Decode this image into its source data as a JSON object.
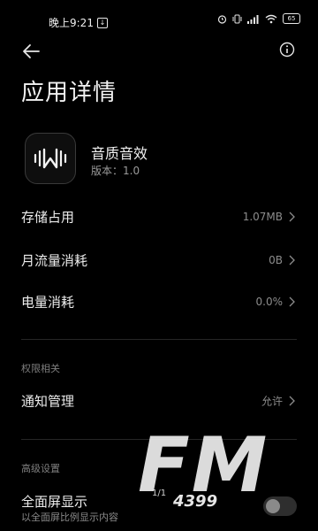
{
  "status_bar": {
    "time": "晚上9:21",
    "battery": "65"
  },
  "header": {
    "back_icon": "arrow-left-icon",
    "info_icon": "info-icon",
    "title": "应用详情"
  },
  "app": {
    "icon": "app-logo-icon",
    "name": "音质音效",
    "version": "版本：1.0"
  },
  "usage": [
    {
      "label": "存储占用",
      "value": "1.07MB"
    },
    {
      "label": "月流量消耗",
      "value": "0B"
    },
    {
      "label": "电量消耗",
      "value": "0.0%"
    }
  ],
  "permissions": {
    "header": "权限相关",
    "notification": {
      "label": "通知管理",
      "value": "允许"
    }
  },
  "advanced": {
    "header": "高级设置",
    "fullscreen": {
      "label": "全面屏显示",
      "sub": "以全面屏比例显示内容",
      "enabled": false
    }
  },
  "page_indicator": "1/1",
  "watermark": {
    "letters": "FM",
    "sub": "4399"
  },
  "colors": {
    "background": "#000000",
    "text_primary": "#ececec",
    "text_secondary": "#8c8c8c"
  }
}
